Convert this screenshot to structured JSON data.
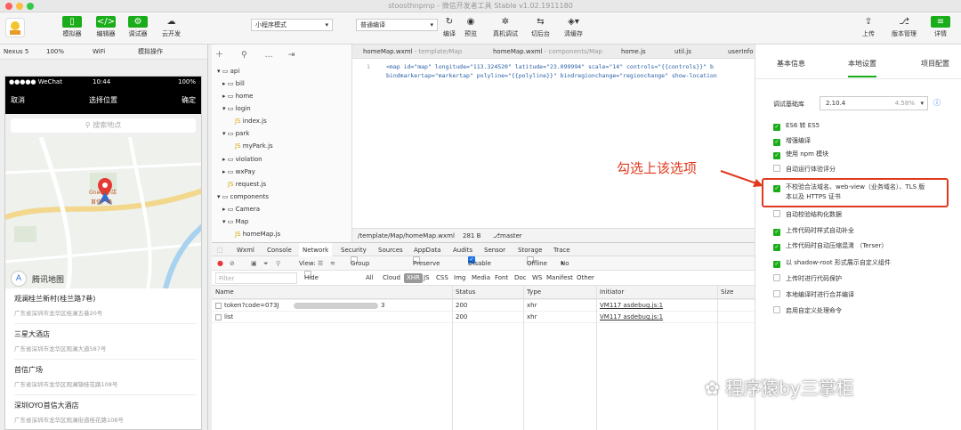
{
  "window": {
    "title": "stoosthnpmp - 微信开发者工具 Stable v1.02.1911180"
  },
  "toolbar": {
    "simulator": "模拟器",
    "editor": "编辑器",
    "debugger": "调试器",
    "cloud": "云开发",
    "mode_select": "小程序模式",
    "compile_select": "普通编译",
    "compile": "编译",
    "preview": "预览",
    "remote_debug": "真机调试",
    "switch_bg": "切后台",
    "clear_cache": "清缓存",
    "upload": "上传",
    "version": "版本管理",
    "details": "详情"
  },
  "simbar": {
    "device": "Nexus 5",
    "zoom": "100%",
    "network": "WiFi",
    "operation": "模拟操作"
  },
  "phone": {
    "carrier": "●●●●● WeChat",
    "time": "10:44",
    "battery": "100%",
    "cancel": "取消",
    "title": "选择位置",
    "confirm": "确定",
    "search_placeholder": "搜索地点",
    "map_labels": [
      "腾讯地图",
      "首信广场",
      "Gnece小店"
    ],
    "places": [
      {
        "name": "观澜桂兰新村(桂兰路7巷)",
        "address": "广东省深圳市龙华区桂澜五巷20号"
      },
      {
        "name": "三星大酒店",
        "address": "广东省深圳市龙华区观澜大道587号"
      },
      {
        "name": "首信广场",
        "address": "广东省深圳市龙华区观澜镇桂花路108号"
      },
      {
        "name": "深圳OYO首信大酒店",
        "address": "广东省深圳市龙华区观澜街道桂花路108号"
      }
    ]
  },
  "tree": {
    "items": [
      {
        "label": "api",
        "type": "folder-open"
      },
      {
        "label": "bill",
        "type": "folder"
      },
      {
        "label": "home",
        "type": "folder"
      },
      {
        "label": "login",
        "type": "folder-open"
      },
      {
        "label": "index.js",
        "type": "file"
      },
      {
        "label": "park",
        "type": "folder-open"
      },
      {
        "label": "myPark.js",
        "type": "file"
      },
      {
        "label": "violation",
        "type": "folder"
      },
      {
        "label": "wxPay",
        "type": "folder"
      },
      {
        "label": "request.js",
        "type": "file"
      },
      {
        "label": "components",
        "type": "folder-open"
      },
      {
        "label": "Camera",
        "type": "folder"
      },
      {
        "label": "Map",
        "type": "folder-open"
      },
      {
        "label": "homeMap.js",
        "type": "file"
      }
    ]
  },
  "editor": {
    "tabs": [
      {
        "label": "homeMap.wxml",
        "hint": "- template/Map"
      },
      {
        "label": "homeMap.wxml",
        "hint": "- components/Map"
      },
      {
        "label": "home.js",
        "hint": ""
      },
      {
        "label": "util.js",
        "hint": ""
      },
      {
        "label": "userInfo",
        "hint": ""
      }
    ],
    "line_no": "1",
    "code_line1": "<map id=\"map\" longitude=\"113.324520\" latitude=\"23.099994\" scale=\"14\" controls=\"{{controls}}\" b",
    "code_line2": "bindmarkertap=\"markertap\" polyline=\"{{polyline}}\" bindregionchange=\"regionchange\" show-location",
    "status_path": "/template/Map/homeMap.wxml",
    "status_size": "281 B",
    "status_branch": "master"
  },
  "devtools": {
    "tabs": [
      "Wxml",
      "Console",
      "Network",
      "Security",
      "Sources",
      "AppData",
      "Audits",
      "Sensor",
      "Storage",
      "Trace"
    ],
    "view_label": "View:",
    "group_by_frame": "Group by frame",
    "preserve_log": "Preserve log",
    "disable_cache": "Disable cache",
    "offline": "Offline",
    "throttle": "No throttling",
    "filter_placeholder": "Filter",
    "hide_data_urls": "Hide data URLs",
    "filter_types": [
      "All",
      "Cloud",
      "XHR",
      "JS",
      "CSS",
      "Img",
      "Media",
      "Font",
      "Doc",
      "WS",
      "Manifest",
      "Other"
    ],
    "columns": [
      "Name",
      "Status",
      "Type",
      "Initiator",
      "Size"
    ],
    "rows": [
      {
        "name": "token?code=073J",
        "tail": "3",
        "status": "200",
        "type": "xhr",
        "initiator": "VM117 asdebug.js:1"
      },
      {
        "name": "list",
        "tail": "",
        "status": "200",
        "type": "xhr",
        "initiator": "VM117 asdebug.js:1"
      }
    ]
  },
  "settings": {
    "tabs": [
      "基本信息",
      "本地设置",
      "项目配置"
    ],
    "base_lib_label": "调试基础库",
    "base_lib_version": "2.10.4",
    "base_lib_pct": "4.58%",
    "options": [
      {
        "label": "ES6 转 ES5",
        "checked": true
      },
      {
        "label": "增强编译",
        "checked": true
      },
      {
        "label": "使用 npm 模块",
        "checked": true
      },
      {
        "label": "自动运行体验评分",
        "checked": false
      },
      {
        "label": "不校验合法域名、web-view（业务域名）、TLS 版",
        "label2": "本以及 HTTPS 证书",
        "checked": true
      },
      {
        "label": "自动校验结构化数据",
        "checked": false
      },
      {
        "label": "上传代码时样式自动补全",
        "checked": true
      },
      {
        "label": "上传代码时自动压缩混淆 （Terser）",
        "checked": true
      },
      {
        "label": "以 shadow-root 形式展示自定义组件",
        "checked": true
      },
      {
        "label": "上传时进行代码保护",
        "checked": false
      },
      {
        "label": "本地编译时进行合并编译",
        "checked": false
      },
      {
        "label": "启用自定义处理命令",
        "checked": false
      }
    ]
  },
  "annotation": "勾选上该选项",
  "watermark": "程序猿by三掌柜",
  "colors": {
    "accent": "#1aad19",
    "annotation": "#e03a1e"
  }
}
